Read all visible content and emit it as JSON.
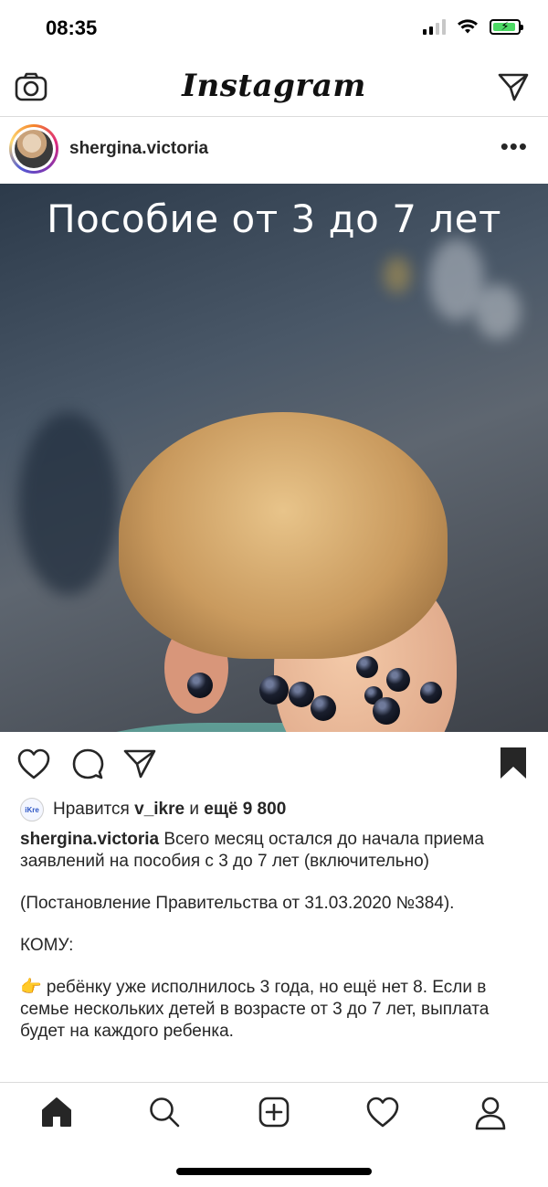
{
  "status_bar": {
    "time": "08:35",
    "signal_bars": 4,
    "signal_active": 2,
    "battery_level": 0.8,
    "battery_charging": true
  },
  "header": {
    "logo": "Instagram",
    "left_icon": "camera-icon",
    "right_icon": "direct-message-icon"
  },
  "post": {
    "username": "shergina.victoria",
    "image_overlay_text": "Пособие от 3 до 7 лет",
    "saved": true,
    "likes": {
      "prefix": "Нравится",
      "user": "v_ikre",
      "connector": "и",
      "others": "ещё 9 800",
      "avatar_text": "iKre"
    },
    "caption": {
      "username": "shergina.victoria",
      "paragraphs": [
        "Всего месяц остался до начала приема заявлений на пособия с 3 до 7 лет (включительно)",
        "(Постановление Правительства от 31.03.2020 №384).",
        "КОМУ:",
        "👉 ребёнку уже исполнилось 3 года, но ещё нет 8. Если в семье нескольких детей в возрасте от 3 до 7 лет, выплата будет на каждого ребенка."
      ]
    }
  },
  "tabbar": {
    "items": [
      "home-icon",
      "search-icon",
      "new-post-icon",
      "activity-icon",
      "profile-icon"
    ],
    "active": "home-icon"
  },
  "colors": {
    "text": "#262626",
    "divider": "#dbdbdb",
    "battery": "#4cd964",
    "story_ring": "#dd2a7b"
  }
}
